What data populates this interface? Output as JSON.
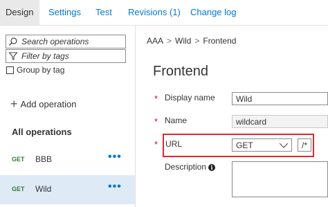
{
  "tabs": [
    {
      "label": "Design",
      "active": true
    },
    {
      "label": "Settings",
      "active": false
    },
    {
      "label": "Test",
      "active": false
    },
    {
      "label": "Revisions (1)",
      "active": false
    },
    {
      "label": "Change log",
      "active": false
    }
  ],
  "sidebar": {
    "search_placeholder": "Search operations",
    "filter_placeholder": "Filter by tags",
    "group_by_tag_label": "Group by tag",
    "add_operation_label": "Add operation",
    "all_operations_label": "All operations",
    "operations": [
      {
        "method": "GET",
        "name": "BBB",
        "more": "•••"
      },
      {
        "method": "GET",
        "name": "Wild",
        "more": "•••",
        "selected": true
      }
    ]
  },
  "breadcrumb": {
    "items": [
      "AAA",
      "Wild",
      "Frontend"
    ],
    "separator": ">"
  },
  "form": {
    "title": "Frontend",
    "required_marker": "*",
    "display_name": {
      "label": "Display name",
      "value": "Wild"
    },
    "name": {
      "label": "Name",
      "value": "wildcard"
    },
    "url": {
      "label": "URL",
      "method": "GET",
      "path": "/*"
    },
    "description": {
      "label": "Description",
      "info_glyph": "i"
    }
  },
  "colors": {
    "accent": "#0078d4",
    "get_method": "#2e7d32",
    "highlight": "#e0262e",
    "required": "#c50f1f"
  }
}
